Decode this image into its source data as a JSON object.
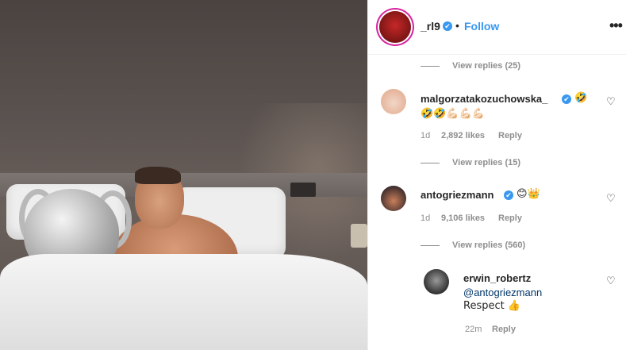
{
  "post": {
    "username": "_rl9",
    "follow_label": "Follow",
    "separator": "•",
    "more_label": "•••"
  },
  "comments": [
    {
      "view_replies_above": "View replies (25)"
    },
    {
      "username": "malgorzatakozuchowska_",
      "text_line1": "🤣",
      "text_line2": "🤣🤣💪🏻💪🏻💪🏻",
      "time": "1d",
      "likes": "2,892 likes",
      "reply": "Reply",
      "view_replies": "View replies (15)"
    },
    {
      "username": "antogriezmann",
      "text": "😊👑",
      "time": "1d",
      "likes": "9,106 likes",
      "reply": "Reply",
      "view_replies": "View replies (560)"
    },
    {
      "username": "erwin_robertz",
      "mention": "@antogriezmann",
      "text": "Respect 👍",
      "time": "22m",
      "reply": "Reply"
    }
  ],
  "icons": {
    "verified": "✔",
    "heart": "♡"
  },
  "colors": {
    "accent_blue": "#3897f0",
    "mention_blue": "#003569",
    "muted": "#8e8e8e"
  }
}
